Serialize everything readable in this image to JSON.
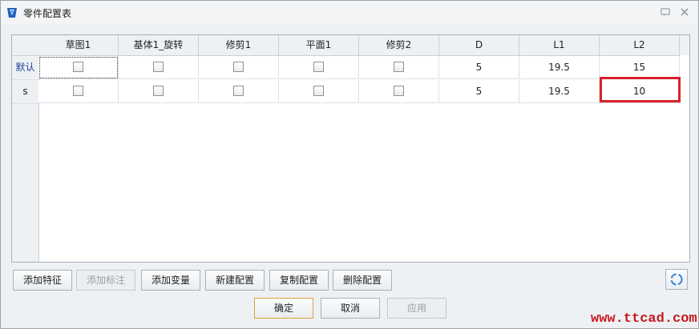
{
  "window": {
    "title": "零件配置表",
    "icons": [
      "app-icon",
      "help-icon",
      "close-icon"
    ]
  },
  "table": {
    "columns": [
      "草图1",
      "基体1_旋转",
      "修剪1",
      "平面1",
      "修剪2",
      "D",
      "L1",
      "L2"
    ],
    "rows": [
      {
        "name": "默认",
        "checks": [
          false,
          false,
          false,
          false,
          false
        ],
        "D": "5",
        "L1": "19.5",
        "L2": "15"
      },
      {
        "name": "s",
        "checks": [
          false,
          false,
          false,
          false,
          false
        ],
        "D": "5",
        "L1": "19.5",
        "L2": "10"
      }
    ]
  },
  "toolbar": {
    "add_feature": "添加特征",
    "add_annotation": "添加标注",
    "add_variable": "添加变量",
    "new_config": "新建配置",
    "copy_config": "复制配置",
    "delete_config": "删除配置"
  },
  "footer": {
    "ok": "确定",
    "cancel": "取消",
    "apply": "应用"
  },
  "watermark": "www.ttcad.com",
  "colors": {
    "highlight_border": "#d8222b",
    "row_name_default": "#1f3fa0",
    "watermark": "#c8191f"
  }
}
